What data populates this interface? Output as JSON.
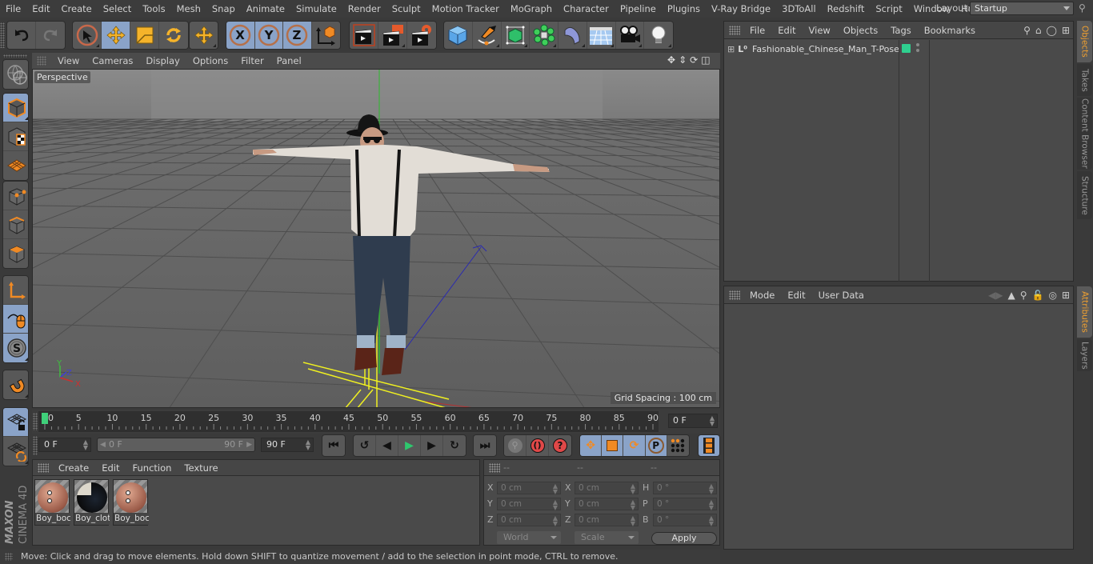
{
  "app": {
    "name": "CINEMA 4D",
    "vendor": "MAXON"
  },
  "menubar": {
    "items": [
      "File",
      "Edit",
      "Create",
      "Select",
      "Tools",
      "Mesh",
      "Snap",
      "Animate",
      "Simulate",
      "Render",
      "Sculpt",
      "Motion Tracker",
      "MoGraph",
      "Character",
      "Pipeline",
      "Plugins",
      "V-Ray Bridge",
      "3DToAll",
      "Redshift",
      "Script",
      "Window",
      "Help"
    ],
    "layout_label": "Layout:",
    "layout_value": "Startup"
  },
  "toolbar": {
    "undo": "undo-icon",
    "redo": "redo-icon",
    "tools": [
      "live-selection-icon",
      "move-icon",
      "scale-icon",
      "rotate-icon",
      "recent-tool-icon"
    ],
    "axis": [
      "X",
      "Y",
      "Z"
    ],
    "coord_system": "world-coordinates-icon",
    "render": [
      "render-view-icon",
      "render-picture-viewer-icon",
      "render-settings-icon"
    ],
    "create": [
      "cube-icon",
      "pen-spline-icon",
      "subdivision-icon",
      "cloner-icon",
      "deformer-icon",
      "floor-icon",
      "camera-icon",
      "light-icon"
    ]
  },
  "viewport": {
    "menu": [
      "View",
      "Cameras",
      "Display",
      "Options",
      "Filter",
      "Panel"
    ],
    "camera_label": "Perspective",
    "grid_spacing": "Grid Spacing : 100 cm",
    "axis_labels": {
      "x": "X",
      "y": "Y",
      "z": "Z"
    }
  },
  "left_tools": [
    "model-mode-icon",
    "texture-mode-icon",
    "workplane-mode-icon",
    "points-mode-icon",
    "edges-mode-icon",
    "polygons-mode-icon",
    "axis-mode-icon",
    "tweak-mode-icon",
    "solo-icon",
    "snap-magnet-icon",
    "lock-workplane-icon",
    "workplane-align-icon"
  ],
  "objects_panel": {
    "menu": [
      "File",
      "Edit",
      "View",
      "Objects",
      "Tags",
      "Bookmarks"
    ],
    "objects": [
      {
        "name": "Fashionable_Chinese_Man_T-Pose",
        "visible_color": "#2fd08f"
      }
    ]
  },
  "attributes_panel": {
    "menu": [
      "Mode",
      "Edit",
      "User Data"
    ]
  },
  "side_tabs": {
    "top": [
      {
        "label": "Objects",
        "active": true
      },
      {
        "label": "Takes",
        "active": false
      },
      {
        "label": "Content Browser",
        "active": false
      },
      {
        "label": "Structure",
        "active": false
      }
    ],
    "bottom": [
      {
        "label": "Attributes",
        "active": true
      },
      {
        "label": "Layers",
        "active": false
      }
    ]
  },
  "timeline": {
    "ticks": [
      "0",
      "5",
      "10",
      "15",
      "20",
      "25",
      "30",
      "35",
      "40",
      "45",
      "50",
      "55",
      "60",
      "65",
      "70",
      "75",
      "80",
      "85",
      "90"
    ],
    "current_frame": "0 F",
    "start_frame": "0 F",
    "range_start": "0 F",
    "range_end": "90 F",
    "end_frame": "90 F",
    "playhead_frame": 0,
    "max_frame": 90
  },
  "materials_panel": {
    "menu": [
      "Create",
      "Edit",
      "Function",
      "Texture"
    ],
    "materials": [
      {
        "label": "Boy_boc",
        "kind": "skin"
      },
      {
        "label": "Boy_clot",
        "kind": "cloth"
      },
      {
        "label": "Boy_boc",
        "kind": "skin"
      }
    ]
  },
  "coordinates_panel": {
    "headers": [
      "--",
      "--",
      "--"
    ],
    "rows": [
      {
        "l1": "X",
        "v1": "0 cm",
        "l2": "X",
        "v2": "0 cm",
        "l3": "H",
        "v3": "0 °"
      },
      {
        "l1": "Y",
        "v1": "0 cm",
        "l2": "Y",
        "v2": "0 cm",
        "l3": "P",
        "v3": "0 °"
      },
      {
        "l1": "Z",
        "v1": "0 cm",
        "l2": "Z",
        "v2": "0 cm",
        "l3": "B",
        "v3": "0 °"
      }
    ],
    "space": "World",
    "mode": "Scale",
    "apply_label": "Apply"
  },
  "statusbar": {
    "text": "Move: Click and drag to move elements. Hold down SHIFT to quantize movement / add to the selection in point mode, CTRL to remove."
  }
}
